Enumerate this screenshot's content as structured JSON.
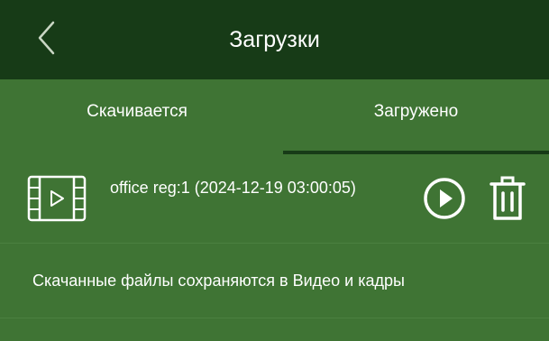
{
  "header": {
    "title": "Загрузки",
    "back_icon": "chevron-left-icon"
  },
  "tabs": [
    {
      "label": "Скачивается",
      "active": false
    },
    {
      "label": "Загружено",
      "active": true
    }
  ],
  "files": [
    {
      "name": "office reg:1 (2024-12-19 03:00:05)",
      "icon": "video-file-icon",
      "actions": [
        "play-icon",
        "trash-icon"
      ]
    }
  ],
  "info_text": "Скачанные файлы сохраняются в Видео и кадры",
  "colors": {
    "header_bg": "#173b17",
    "body_bg": "#3f7434",
    "text": "#ffffff",
    "divider": "#4b8040"
  }
}
